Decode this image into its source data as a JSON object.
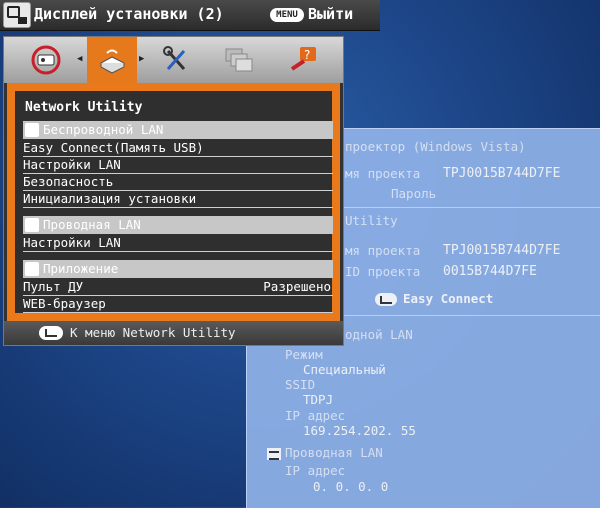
{
  "header": {
    "title": "Дисплей установки (2)",
    "menu_key": "MENU",
    "exit_label": "Выйти"
  },
  "menu": {
    "section_title": "Network Utility",
    "groups": [
      {
        "header": "Беспроводной LAN",
        "items": [
          "Easy Connect(Память USB)",
          "Настройки LAN",
          "Безопасность",
          "Инициализация установки"
        ]
      },
      {
        "header": "Проводная LAN",
        "items": [
          "Настройки LAN"
        ]
      },
      {
        "header": "Приложение",
        "items": [
          "Пульт ДУ",
          "WEB-браузер"
        ]
      }
    ],
    "remote_value": "Разрешено",
    "footer": "К меню Network Utility"
  },
  "info": {
    "line1": "проектор (Windows Vista)",
    "name_label_1": "мя проекта",
    "name_value_1": "TPJ0015B744D7FE",
    "password_label": "Пароль",
    "utility_label": "Utility",
    "name_label_2": "мя проекта",
    "name_value_2": "TPJ0015B744D7FE",
    "ssid_label_1": "ID проекта",
    "ssid_value_1": "0015B744D7FE",
    "easy_connect": "Easy Connect",
    "wireless_label": "одной LAN",
    "mode_label": "Режим",
    "mode_value": "Специальный",
    "ssid_label_2": "SSID",
    "ssid_value_2": "TDPJ",
    "ip_label_1": "IP адрес",
    "ip_value_1": "169.254.202. 55",
    "wired_label": "Проводная LAN",
    "ip_label_2": "IP адрес",
    "ip_value_2": "0.  0.  0.  0"
  }
}
